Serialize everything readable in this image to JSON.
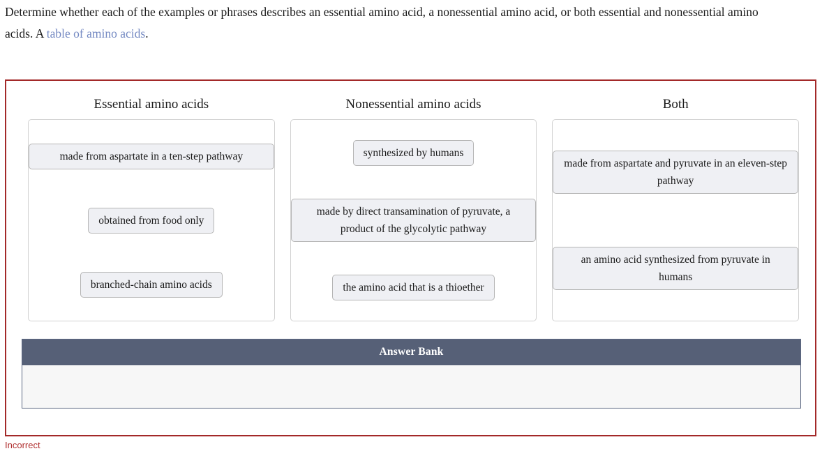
{
  "prompt": {
    "text_before_link": "Determine whether each of the examples or phrases describes an essential amino acid, a nonessential amino acid, or both essential and nonessential amino acids. A ",
    "link_label": "table of amino acids",
    "text_after_link": "."
  },
  "colors": {
    "panel_border": "#a32929",
    "link": "#7489c2",
    "answer_bank_header_bg": "#566077",
    "answer_bank_body_bg": "#f7f7f7",
    "tile_bg": "#eff0f4",
    "tile_border": "#b5b5b5",
    "dropzone_border": "#d2d2d2",
    "status": "#b03030"
  },
  "categories": [
    {
      "header": "Essential amino acids",
      "tiles": [
        {
          "label": "made from aspartate in a ten-step pathway",
          "wide": true
        },
        {
          "label": "obtained from food only",
          "wide": false
        },
        {
          "label": "branched-chain amino acids",
          "wide": false
        }
      ]
    },
    {
      "header": "Nonessential amino acids",
      "tiles": [
        {
          "label": "synthesized by humans",
          "wide": false
        },
        {
          "label": "made by direct transamination of pyruvate, a product of the glycolytic pathway",
          "wide": true
        },
        {
          "label": "the amino acid that is a thioether",
          "wide": false
        }
      ]
    },
    {
      "header": "Both",
      "tiles": [
        {
          "label": "made from aspartate and pyruvate in an eleven-step pathway",
          "wide": true
        },
        {
          "label": "an amino acid synthesized from pyruvate in humans",
          "wide": true
        }
      ]
    }
  ],
  "answer_bank": {
    "title": "Answer Bank",
    "items": []
  },
  "status": {
    "label": "Incorrect"
  }
}
